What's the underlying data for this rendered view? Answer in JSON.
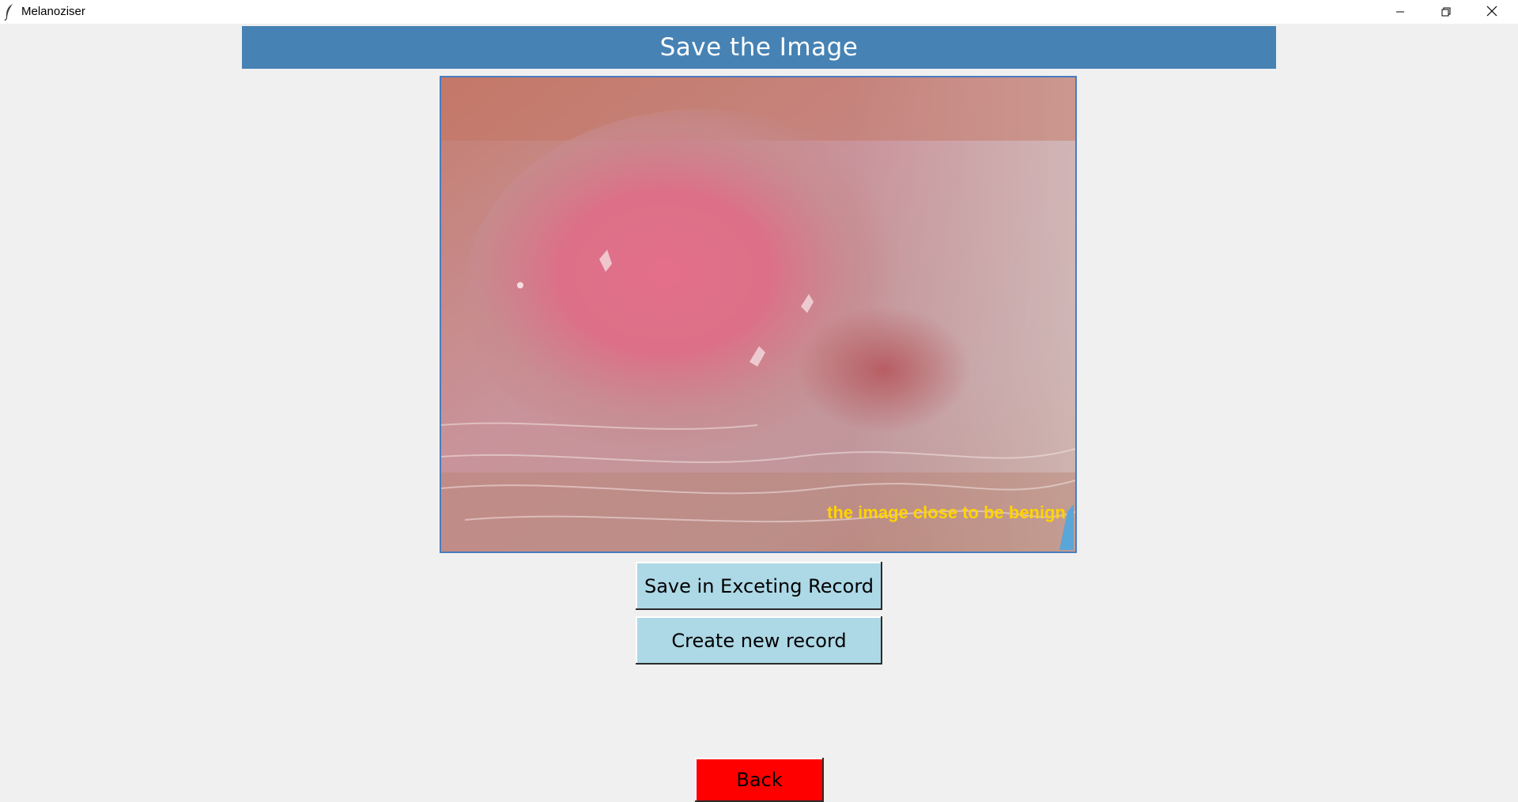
{
  "window": {
    "title": "Melanoziser",
    "icons": {
      "app": "feather-icon",
      "minimize": "minimize-icon",
      "maximize": "restore-icon",
      "close": "close-icon"
    }
  },
  "header": {
    "title": "Save the Image",
    "color": "#4682b4"
  },
  "image": {
    "caption": "the image close to be benign",
    "caption_color": "#ffd400"
  },
  "actions": {
    "save_existing_label": "Save in Exceting Record",
    "create_new_label": "Create new record",
    "back_label": "Back",
    "button_color": "#add8e6",
    "back_color": "#ff0000"
  }
}
